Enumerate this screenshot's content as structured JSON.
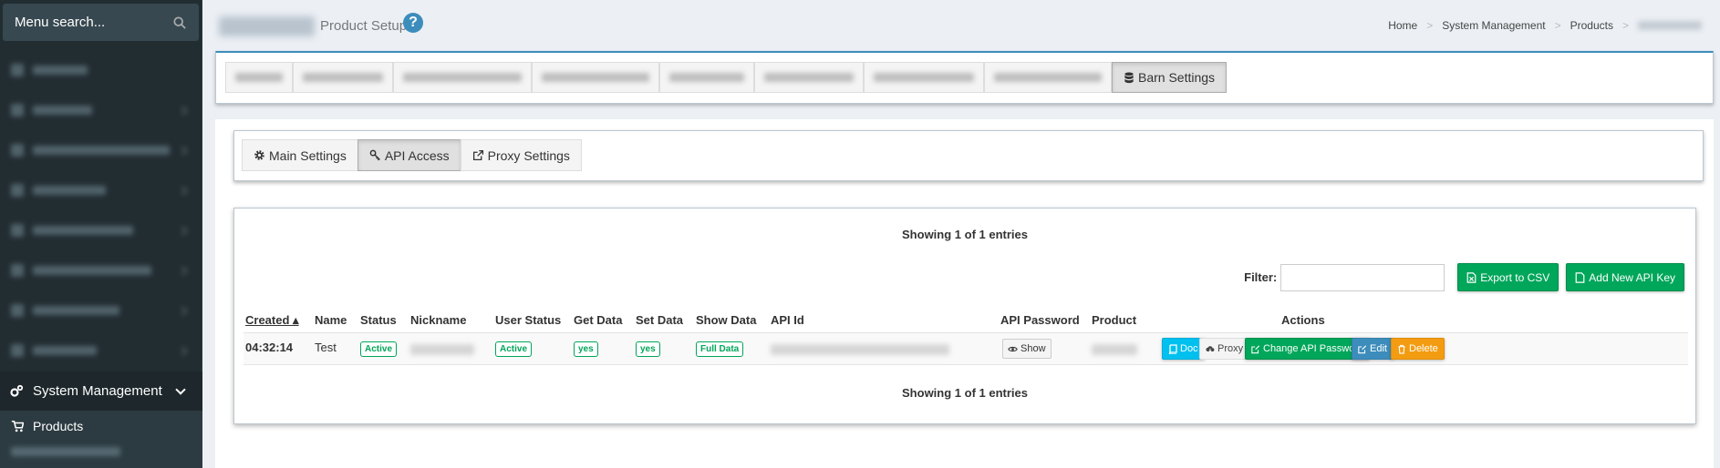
{
  "sidebar": {
    "search_placeholder": "Menu search...",
    "active_section": "System Management",
    "sub_item": "Products"
  },
  "header": {
    "page_title": "Product Setup",
    "help": "?",
    "breadcrumb": [
      "Home",
      "System Management",
      "Products"
    ]
  },
  "top_tabs": {
    "active": "Barn Settings"
  },
  "inner_tabs": [
    "Main Settings",
    "API Access",
    "Proxy Settings"
  ],
  "table": {
    "showing_top": "Showing 1 of 1 entries",
    "showing_bottom": "Showing 1 of 1 entries",
    "filter_label": "Filter:",
    "filter_value": "",
    "export_label": "Export to CSV",
    "add_label": "Add New API Key",
    "columns": [
      "Created",
      "Name",
      "Status",
      "Nickname",
      "User Status",
      "Get Data",
      "Set Data",
      "Show Data",
      "API Id",
      "API Password",
      "Product",
      "Actions"
    ],
    "rows": [
      {
        "created": "04:32:14",
        "name": "Test",
        "status": "Active",
        "user_status": "Active",
        "get_data": "yes",
        "set_data": "yes",
        "show_data": "Full Data",
        "password_btn": "Show"
      }
    ],
    "actions": {
      "doc": "Doc",
      "proxy": "Proxy",
      "change_password": "Change API Password",
      "edit": "Edit",
      "delete": "Delete"
    }
  },
  "colors": {
    "green": "#00a65a",
    "blue": "#3c8dbc",
    "aqua": "#00c0ef",
    "orange": "#f39c12",
    "sidebar": "#222d32"
  }
}
